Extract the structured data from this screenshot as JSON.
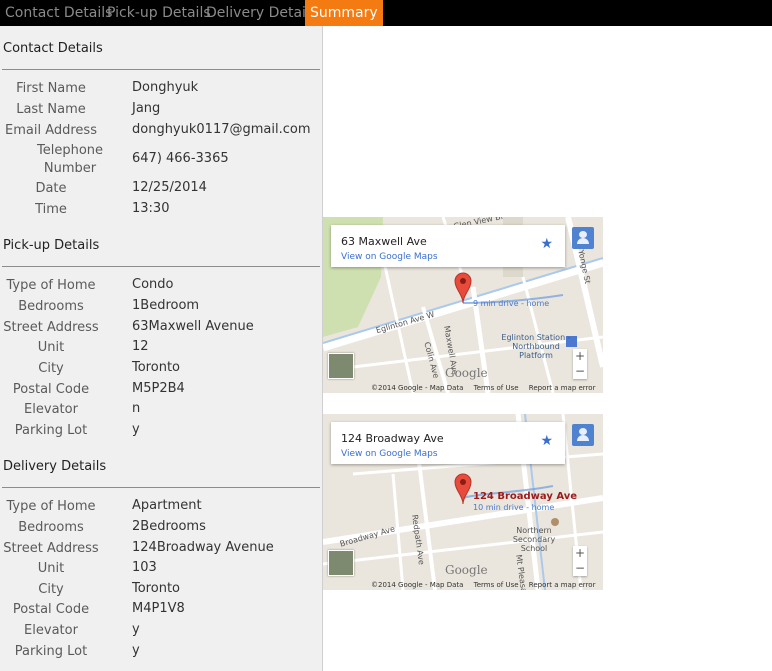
{
  "nav": {
    "tabs": [
      {
        "label": "Contact Details"
      },
      {
        "label": "Pick-up Details"
      },
      {
        "label": "Delivery Details"
      },
      {
        "label": "Summary"
      }
    ],
    "active_color": "#f47a12"
  },
  "contact": {
    "title": "Contact Details",
    "fields": [
      {
        "label": "First Name",
        "value": "Donghyuk"
      },
      {
        "label": "Last Name",
        "value": "Jang"
      },
      {
        "label": "Email Address",
        "value": "donghyuk0117@gmail.com"
      },
      {
        "label": "Telephone Number",
        "value": "647) 466-3365"
      },
      {
        "label": "Date",
        "value": "12/25/2014"
      },
      {
        "label": "Time",
        "value": "13:30"
      }
    ]
  },
  "pickup": {
    "title": "Pick-up Details",
    "fields": [
      {
        "label": "Type of Home",
        "value": "Condo"
      },
      {
        "label": "Bedrooms",
        "value": "1Bedroom"
      },
      {
        "label": "Street Address",
        "value": "63Maxwell Avenue"
      },
      {
        "label": "Unit",
        "value": "12"
      },
      {
        "label": "City",
        "value": "Toronto"
      },
      {
        "label": "Postal Code",
        "value": "M5P2B4"
      },
      {
        "label": "Elevator",
        "value": "n"
      },
      {
        "label": "Parking Lot",
        "value": "y"
      }
    ]
  },
  "delivery": {
    "title": "Delivery Details",
    "fields": [
      {
        "label": "Type of Home",
        "value": "Apartment"
      },
      {
        "label": "Bedrooms",
        "value": "2Bedrooms"
      },
      {
        "label": "Street Address",
        "value": "124Broadway Avenue"
      },
      {
        "label": "Unit",
        "value": "103"
      },
      {
        "label": "City",
        "value": "Toronto"
      },
      {
        "label": "Postal Code",
        "value": "M4P1V8"
      },
      {
        "label": "Elevator",
        "value": "y"
      },
      {
        "label": "Parking Lot",
        "value": "y"
      }
    ]
  },
  "maps": [
    {
      "info_title": "63 Maxwell Ave",
      "info_link": "View on Google Maps",
      "drive": "9 min drive - home",
      "streets": {
        "a": "Eglinton Ave W",
        "b": "Maxwell Ave",
        "c": "Colin Ave",
        "d": "Yonge St",
        "e": "Glen View Bl"
      },
      "station": "Eglinton Station - Northbound Platform",
      "google": "Google",
      "attribution": [
        "©2014 Google - Map Data",
        "Terms of Use",
        "Report a map error"
      ],
      "zoom": [
        "+",
        "−"
      ]
    },
    {
      "info_title": "124 Broadway Ave",
      "info_link": "View on Google Maps",
      "marker_label": "124 Broadway Ave",
      "drive": "10 min drive - home",
      "streets": {
        "a": "Broadway Ave",
        "b": "Redpath Ave",
        "c": "Mt Pleasant"
      },
      "school": "Northern Secondary School",
      "google": "Google",
      "attribution": [
        "©2014 Google - Map Data",
        "Terms of Use",
        "Report a map error"
      ],
      "zoom": [
        "+",
        "−"
      ]
    }
  ]
}
